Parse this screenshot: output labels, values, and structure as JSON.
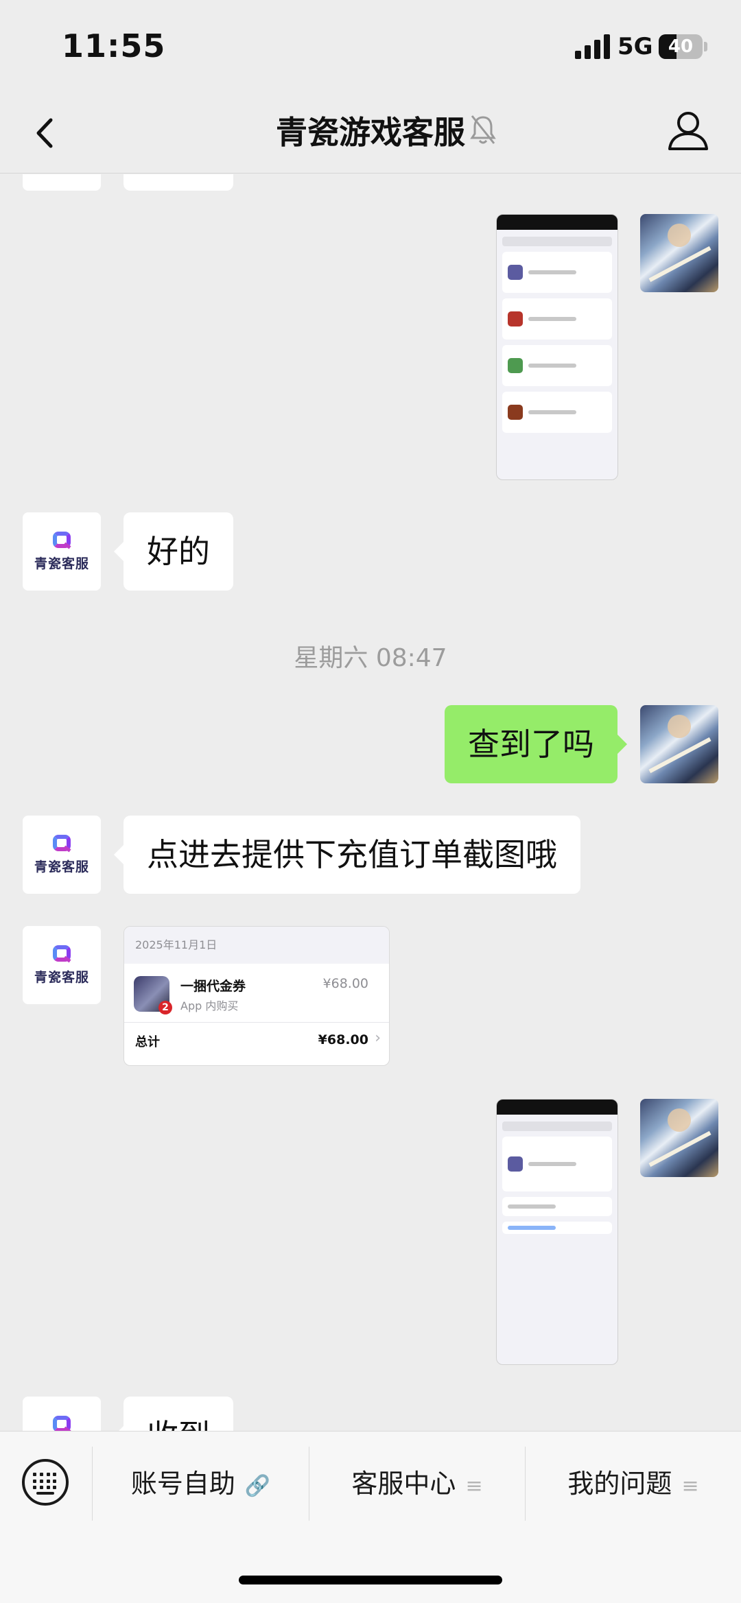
{
  "status_bar": {
    "time": "11:55",
    "network": "5G",
    "battery": "40",
    "battery_level": 0.4
  },
  "header": {
    "title": "青瓷游戏客服"
  },
  "support_logo_text": "青瓷客服",
  "messages": {
    "m1_text": "好的",
    "time_divider": "星期六 08:47",
    "m2_text": "查到了吗",
    "m3_text": "点进去提供下充值订单截图哦",
    "m5_text": "收到"
  },
  "order_card": {
    "date": "2025年11月1日",
    "item_name": "一捆代金券",
    "item_sub": "App 内购买",
    "price": "¥68.00",
    "total_label": "总计",
    "total_price": "¥68.00"
  },
  "bottom_menu": {
    "item1": "账号自助",
    "item2": "客服中心",
    "item3": "我的问题"
  },
  "icons": [
    "back-icon",
    "mute-bell-icon",
    "profile-icon",
    "keyboard-icon",
    "link-icon",
    "menu-lines-icon"
  ]
}
